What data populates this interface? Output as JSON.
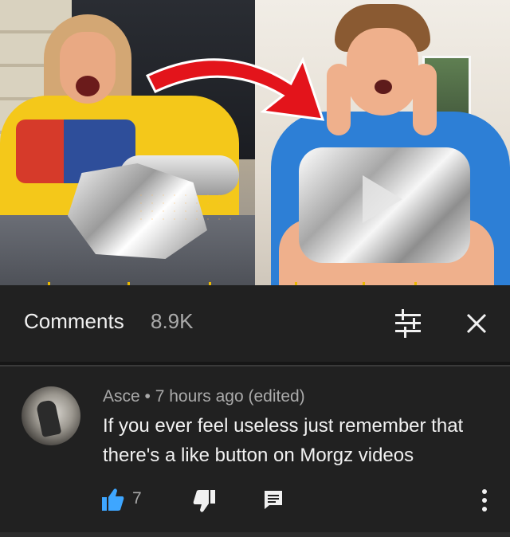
{
  "thumbnail": {
    "left_icon": "saw-cutting-plaque",
    "right_icon": "person-holding-diamond-play-button",
    "arrow_icon": "red-curved-arrow"
  },
  "comments_header": {
    "title": "Comments",
    "count": "8.9K",
    "filter_icon": "sort-filter-icon",
    "close_icon": "close-icon"
  },
  "comment": {
    "author": "Asce",
    "time": "7 hours ago (edited)",
    "text": "If you ever feel useless just remember that there's a like button on Morgz videos",
    "likes": "7",
    "like_color": "#3ea6ff"
  }
}
